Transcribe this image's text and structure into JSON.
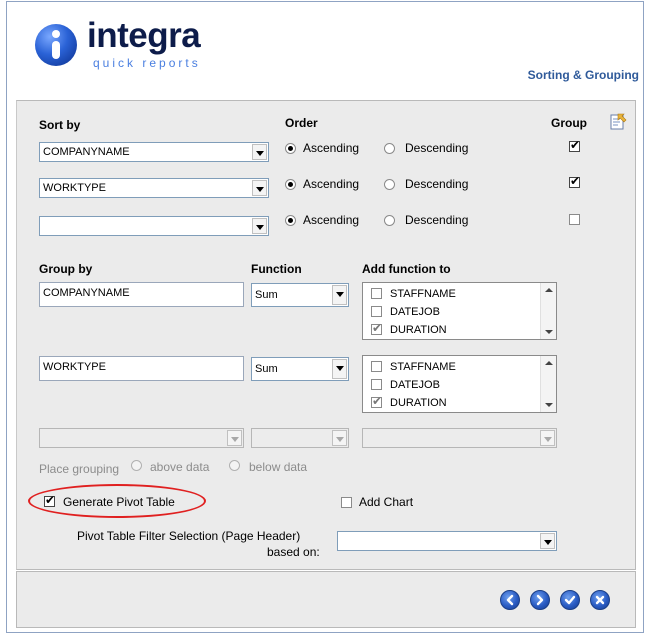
{
  "header": {
    "logo_text": "integra",
    "logo_subtext": "quick reports",
    "page_title": "Sorting & Grouping"
  },
  "sort": {
    "label": "Sort by",
    "order_label": "Order",
    "group_label": "Group",
    "ascending_label": "Ascending",
    "descending_label": "Descending",
    "rows": [
      {
        "value": "COMPANYNAME",
        "order": "ascending",
        "group": true
      },
      {
        "value": "WORKTYPE",
        "order": "ascending",
        "group": true
      },
      {
        "value": "",
        "order": "ascending",
        "group": false
      }
    ]
  },
  "grouping": {
    "label": "Group by",
    "function_label": "Function",
    "add_function_label": "Add function to",
    "rows": [
      {
        "group_by": "COMPANYNAME",
        "function": "Sum",
        "fields": [
          {
            "name": "STAFFNAME",
            "checked": false
          },
          {
            "name": "DATEJOB",
            "checked": false
          },
          {
            "name": "DURATION",
            "checked": true
          }
        ]
      },
      {
        "group_by": "WORKTYPE",
        "function": "Sum",
        "fields": [
          {
            "name": "STAFFNAME",
            "checked": false
          },
          {
            "name": "DATEJOB",
            "checked": false
          },
          {
            "name": "DURATION",
            "checked": true
          }
        ]
      }
    ]
  },
  "placement": {
    "label": "Place grouping",
    "above_label": "above data",
    "below_label": "below data"
  },
  "options": {
    "pivot_label": "Generate Pivot Table",
    "pivot_checked": true,
    "chart_label": "Add Chart",
    "chart_checked": false,
    "filter_label_line1": "Pivot Table Filter Selection (Page Header)",
    "filter_label_line2": "based on:",
    "filter_value": ""
  },
  "icons": {
    "nav": [
      "back-icon",
      "forward-icon",
      "confirm-icon",
      "cancel-icon"
    ],
    "accent_color": "#2a5cc4",
    "highlight_color": "#e02020"
  }
}
